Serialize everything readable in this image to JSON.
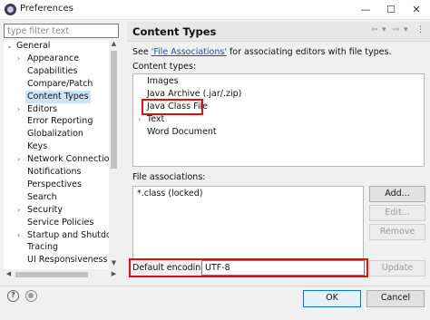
{
  "window": {
    "title": "Preferences",
    "minimize_glyph": "—",
    "maximize_glyph": "☐",
    "close_glyph": "✕"
  },
  "filter": {
    "placeholder": "type filter text"
  },
  "tree": {
    "items": [
      {
        "label": "General",
        "indent": 0,
        "expander": "⌄"
      },
      {
        "label": "Appearance",
        "indent": 1,
        "expander": "›"
      },
      {
        "label": "Capabilities",
        "indent": 1,
        "expander": ""
      },
      {
        "label": "Compare/Patch",
        "indent": 1,
        "expander": ""
      },
      {
        "label": "Content Types",
        "indent": 1,
        "expander": "",
        "selected": true
      },
      {
        "label": "Editors",
        "indent": 1,
        "expander": "›"
      },
      {
        "label": "Error Reporting",
        "indent": 1,
        "expander": ""
      },
      {
        "label": "Globalization",
        "indent": 1,
        "expander": ""
      },
      {
        "label": "Keys",
        "indent": 1,
        "expander": ""
      },
      {
        "label": "Network Connections",
        "indent": 1,
        "expander": "›"
      },
      {
        "label": "Notifications",
        "indent": 1,
        "expander": ""
      },
      {
        "label": "Perspectives",
        "indent": 1,
        "expander": ""
      },
      {
        "label": "Search",
        "indent": 1,
        "expander": ""
      },
      {
        "label": "Security",
        "indent": 1,
        "expander": "›"
      },
      {
        "label": "Service Policies",
        "indent": 1,
        "expander": ""
      },
      {
        "label": "Startup and Shutdown",
        "indent": 1,
        "expander": "›"
      },
      {
        "label": "Tracing",
        "indent": 1,
        "expander": ""
      },
      {
        "label": "UI Responsiveness Mo",
        "indent": 1,
        "expander": ""
      }
    ]
  },
  "page": {
    "title": "Content Types",
    "nav_back_glyph": "⇦",
    "nav_forward_glyph": "⇨",
    "nav_menu_glyph": "▾",
    "menu_glyph": "⋮",
    "see_prefix": "See ",
    "see_link": "'File Associations'",
    "see_suffix": " for associating editors with file types.",
    "content_types_label": "Content types:",
    "content_types": [
      {
        "label": "Images",
        "expander": ""
      },
      {
        "label": "Java Archive (.jar/.zip)",
        "expander": ""
      },
      {
        "label": "Java Class File",
        "expander": "",
        "highlighted": true
      },
      {
        "label": "Text",
        "expander": "›"
      },
      {
        "label": "Word Document",
        "expander": ""
      }
    ],
    "file_assoc_label": "File associations:",
    "file_assoc_items": [
      "*.class (locked)"
    ],
    "buttons": {
      "add": "Add...",
      "edit": "Edit...",
      "remove": "Remove",
      "update": "Update"
    },
    "encoding_label": "Default encoding:",
    "encoding_value": "UTF-8"
  },
  "footer": {
    "ok": "OK",
    "cancel": "Cancel"
  },
  "colors": {
    "highlight": "#e01010",
    "link": "#1a4fc4",
    "selection": "#cce4f7",
    "ok_border": "#0078d7"
  }
}
